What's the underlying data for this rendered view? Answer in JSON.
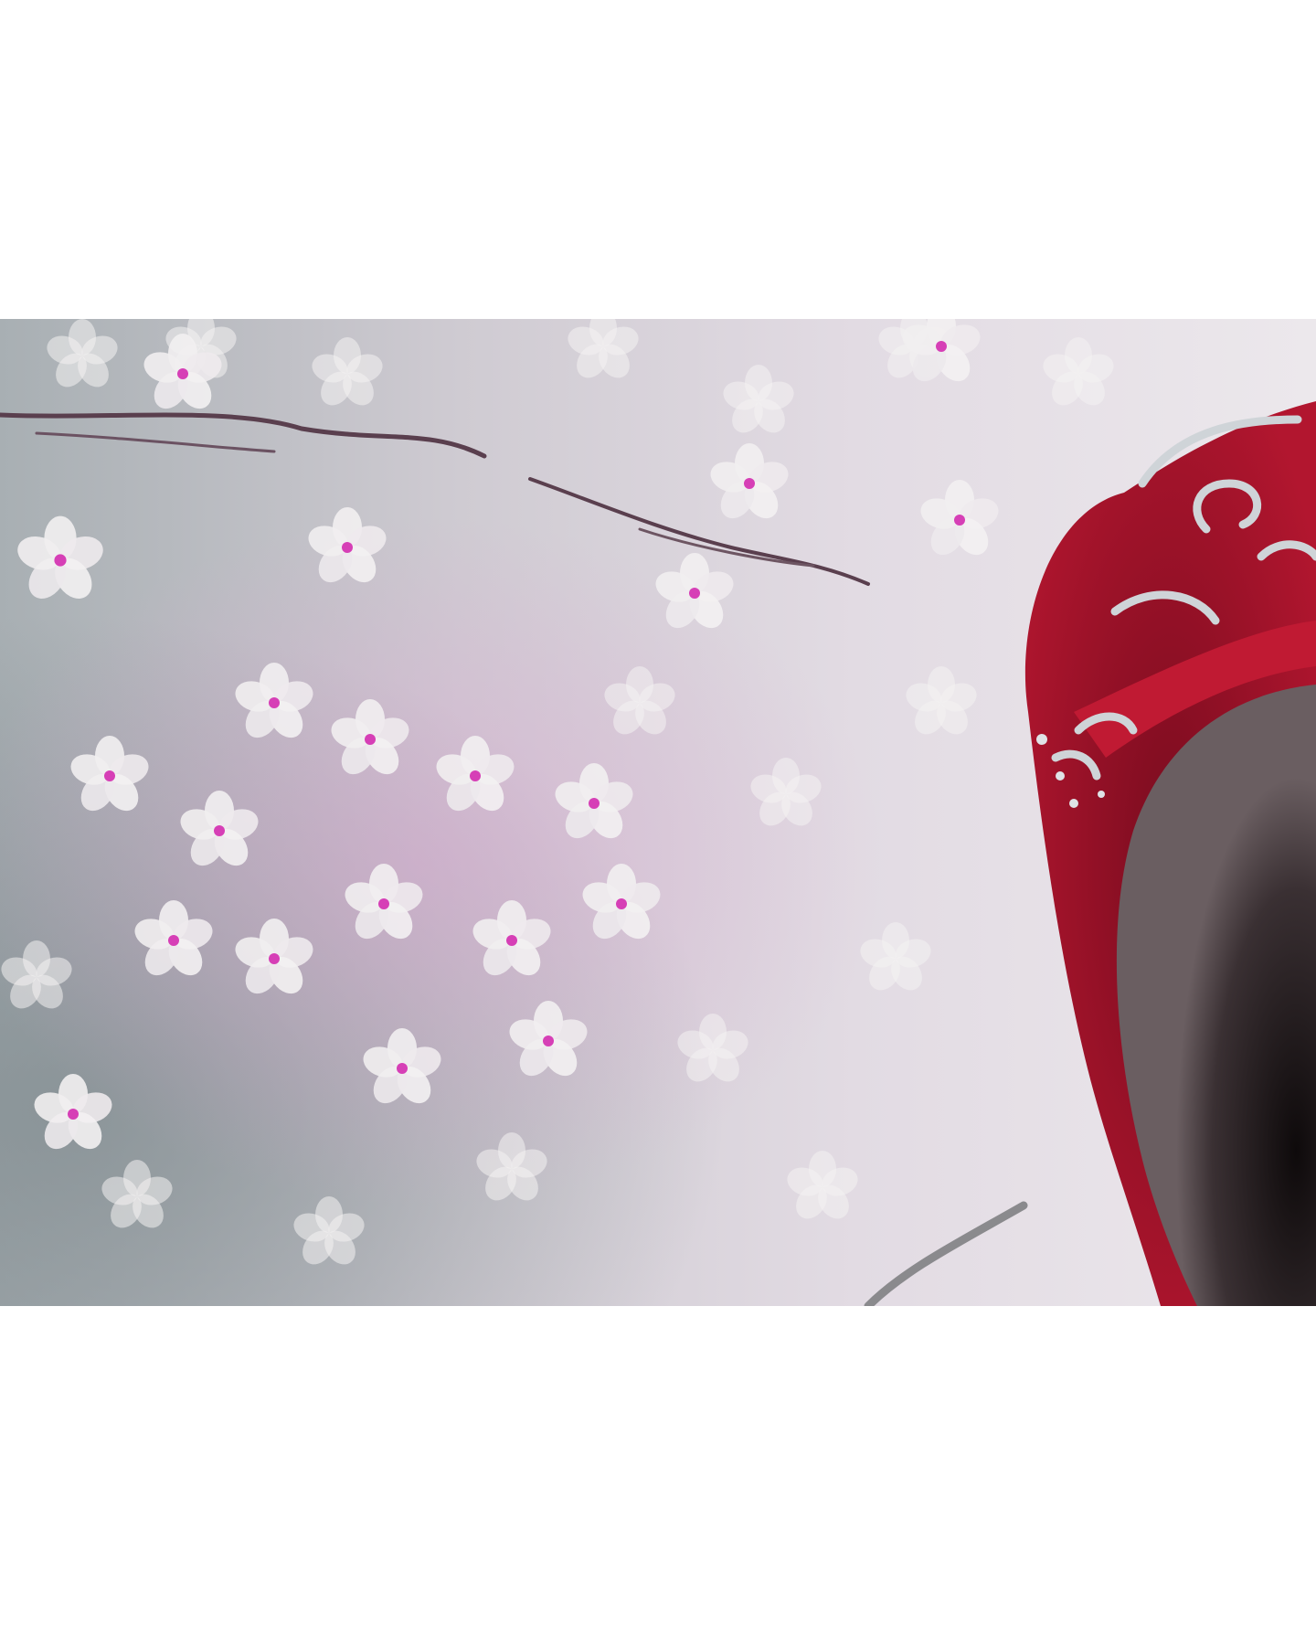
{
  "image": {
    "subject": "painting-closeup-cherry-blossoms-and-red-headpiece",
    "colors": {
      "background": "#ffffff",
      "canvas_base": "#d9d3db",
      "blossom_white": "#f1eff0",
      "blossom_pink": "#d63fb6",
      "branch": "#5a3f4e",
      "headpiece_red": "#a3152e",
      "hair_dark": "#2a2224",
      "ornament_silver": "#cfd4d8"
    }
  }
}
